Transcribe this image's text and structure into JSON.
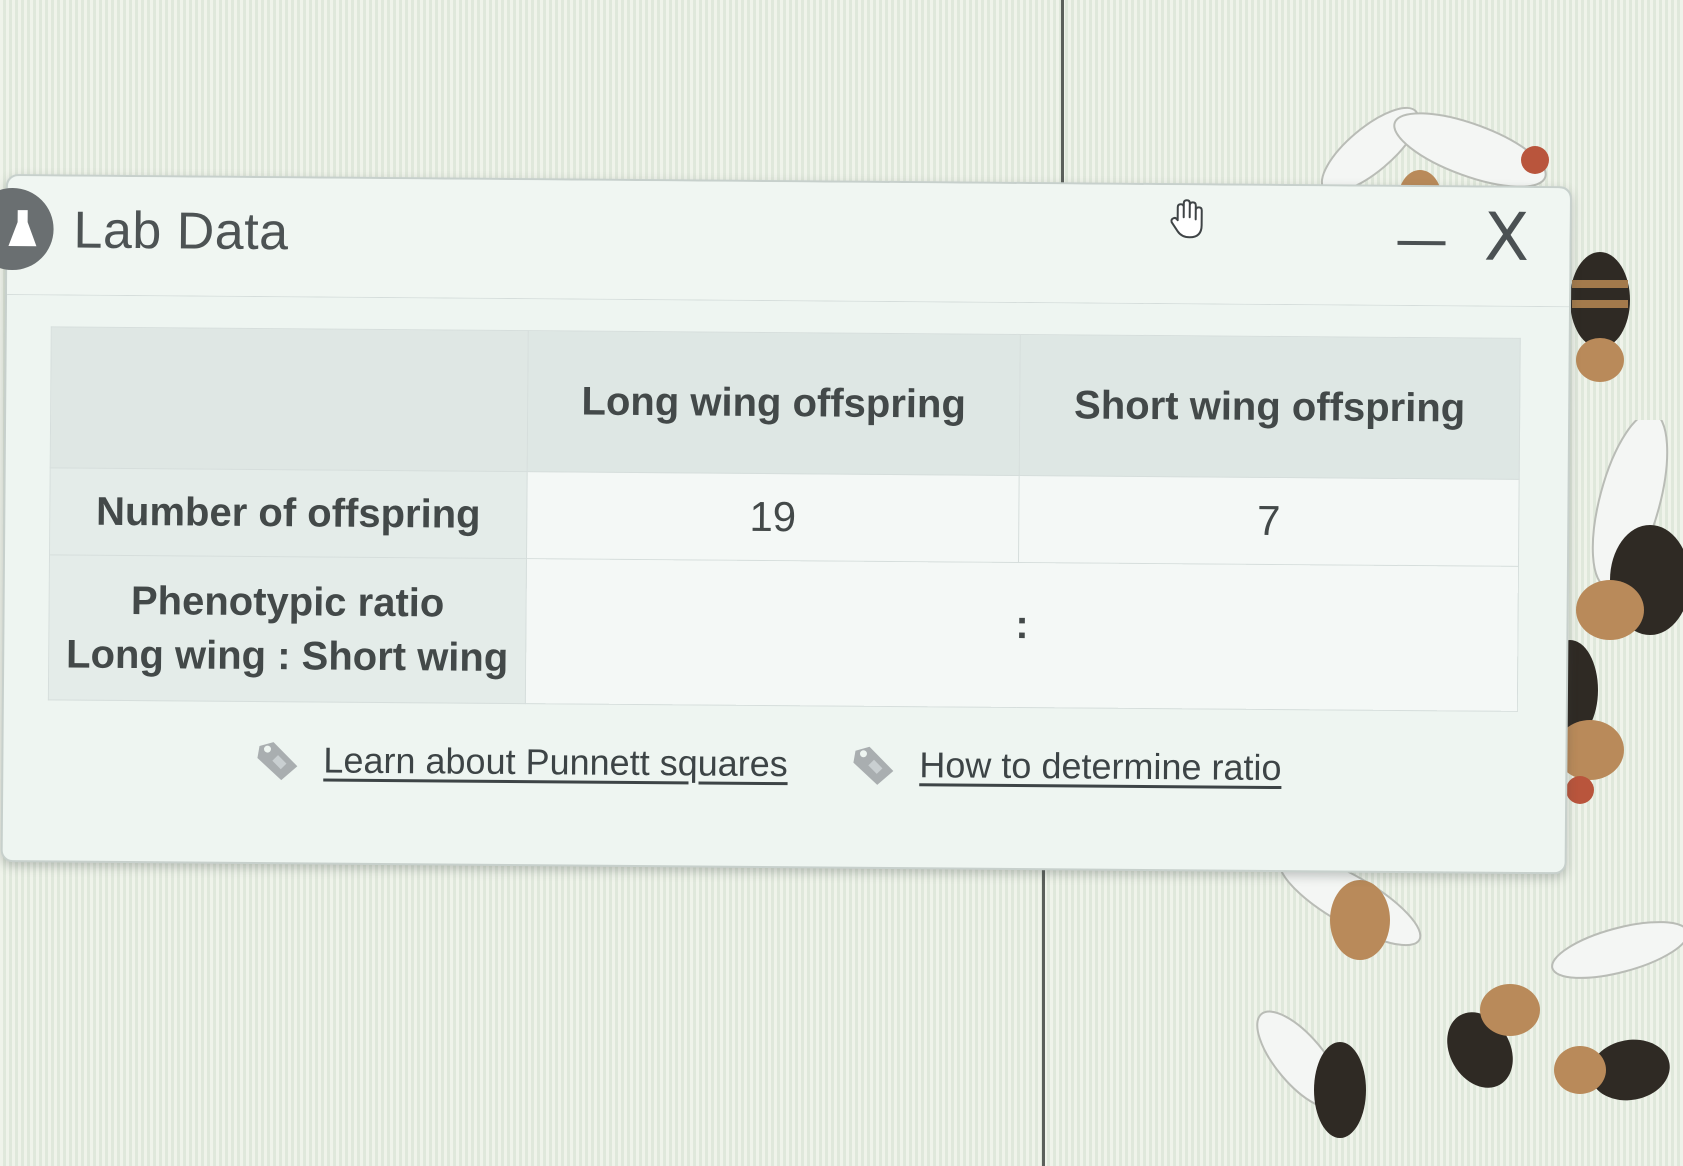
{
  "window": {
    "title": "Lab Data",
    "minimize_label": "—",
    "close_label": "X"
  },
  "table": {
    "headers": [
      "",
      "Long wing offspring",
      "Short wing offspring"
    ],
    "rows": [
      {
        "label": "Number of offspring",
        "values": [
          "19",
          "7"
        ]
      },
      {
        "label_line1": "Phenotypic ratio",
        "label_line2": "Long wing : Short wing",
        "separator": ":"
      }
    ]
  },
  "links": [
    {
      "label": "Learn about Punnett squares",
      "icon": "tag-icon"
    },
    {
      "label": "How to determine ratio",
      "icon": "tag-icon"
    }
  ],
  "colors": {
    "window_bg": "#eef5f1",
    "header_bg": "#dee7e4",
    "text": "#434949",
    "icon_gray": "#6a6f71"
  }
}
